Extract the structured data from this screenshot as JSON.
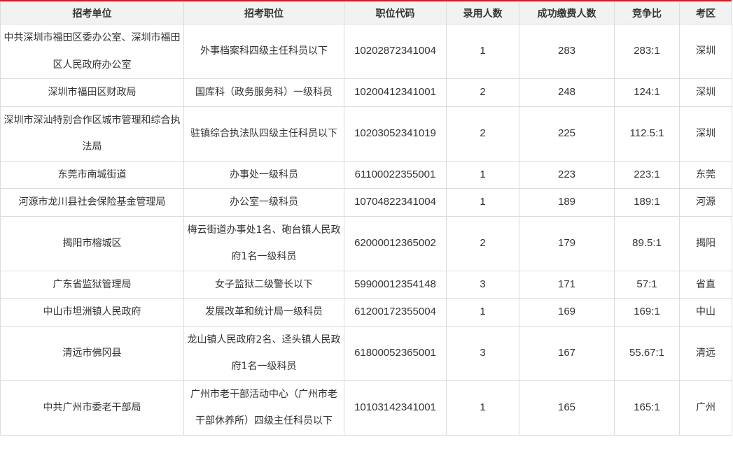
{
  "table": {
    "headers": [
      "招考单位",
      "招考职位",
      "职位代码",
      "录用人数",
      "成功缴费人数",
      "竞争比",
      "考区"
    ],
    "rows": [
      {
        "unit": "中共深圳市福田区委办公室、深圳市福田区人民政府办公室",
        "position": "外事档案科四级主任科员以下",
        "code": "10202872341004",
        "hires": "1",
        "paid": "283",
        "ratio": "283:1",
        "region": "深圳"
      },
      {
        "unit": "深圳市福田区财政局",
        "position": "国库科（政务服务科）一级科员",
        "code": "10200412341001",
        "hires": "2",
        "paid": "248",
        "ratio": "124:1",
        "region": "深圳"
      },
      {
        "unit": "深圳市深汕特别合作区城市管理和综合执法局",
        "position": "驻镇综合执法队四级主任科员以下",
        "code": "10203052341019",
        "hires": "2",
        "paid": "225",
        "ratio": "112.5:1",
        "region": "深圳"
      },
      {
        "unit": "东莞市南城街道",
        "position": "办事处一级科员",
        "code": "61100022355001",
        "hires": "1",
        "paid": "223",
        "ratio": "223:1",
        "region": "东莞"
      },
      {
        "unit": "河源市龙川县社会保险基金管理局",
        "position": "办公室一级科员",
        "code": "10704822341004",
        "hires": "1",
        "paid": "189",
        "ratio": "189:1",
        "region": "河源"
      },
      {
        "unit": "揭阳市榕城区",
        "position": "梅云街道办事处1名、砲台镇人民政府1名一级科员",
        "code": "62000012365002",
        "hires": "2",
        "paid": "179",
        "ratio": "89.5:1",
        "region": "揭阳"
      },
      {
        "unit": "广东省监狱管理局",
        "position": "女子监狱二级警长以下",
        "code": "59900012354148",
        "hires": "3",
        "paid": "171",
        "ratio": "57:1",
        "region": "省直"
      },
      {
        "unit": "中山市坦洲镇人民政府",
        "position": "发展改革和统计局一级科员",
        "code": "61200172355004",
        "hires": "1",
        "paid": "169",
        "ratio": "169:1",
        "region": "中山"
      },
      {
        "unit": "清远市佛冈县",
        "position": "龙山镇人民政府2名、迳头镇人民政府1名一级科员",
        "code": "61800052365001",
        "hires": "3",
        "paid": "167",
        "ratio": "55.67:1",
        "region": "清远"
      },
      {
        "unit": "中共广州市委老干部局",
        "position": "广州市老干部活动中心（广州市老干部休养所）四级主任科员以下",
        "code": "10103142341001",
        "hires": "1",
        "paid": "165",
        "ratio": "165:1",
        "region": "广州"
      }
    ]
  }
}
